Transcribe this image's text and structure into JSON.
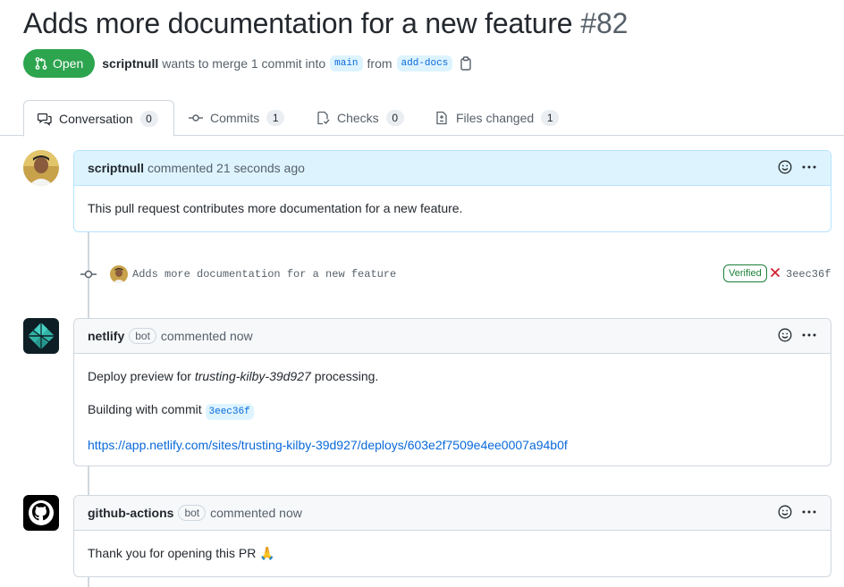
{
  "pr": {
    "title": "Adds more documentation for a new feature",
    "number": "#82",
    "state": "Open",
    "author": "scriptnull",
    "merge_text": "wants to merge 1 commit into",
    "base_branch": "main",
    "from_text": "from",
    "head_branch": "add-docs"
  },
  "tabs": [
    {
      "label": "Conversation",
      "count": "0"
    },
    {
      "label": "Commits",
      "count": "1"
    },
    {
      "label": "Checks",
      "count": "0"
    },
    {
      "label": "Files changed",
      "count": "1"
    }
  ],
  "comments": [
    {
      "author": "scriptnull",
      "meta": "commented 21 seconds ago",
      "body": "This pull request contributes more documentation for a new feature."
    },
    {
      "author": "netlify",
      "bot_label": "bot",
      "meta": "commented now",
      "line1_prefix": "Deploy preview for",
      "line1_site": "trusting-kilby-39d927",
      "line1_suffix": "processing.",
      "line2_prefix": "Building with commit",
      "line2_sha": "3eec36f",
      "link": "https://app.netlify.com/sites/trusting-kilby-39d927/deploys/603e2f7509e4ee0007a94b0f"
    },
    {
      "author": "github-actions",
      "bot_label": "bot",
      "meta": "commented now",
      "body": "Thank you for opening this PR 🙏"
    }
  ],
  "commit": {
    "message": "Adds more documentation for a new feature",
    "verified": "Verified",
    "sha": "3eec36f",
    "status_icon": "x-icon"
  },
  "colors": {
    "open_green": "#2da44e",
    "link_blue": "#0969da",
    "verified_green": "#1a7f37",
    "fail_red": "#cf222e"
  }
}
